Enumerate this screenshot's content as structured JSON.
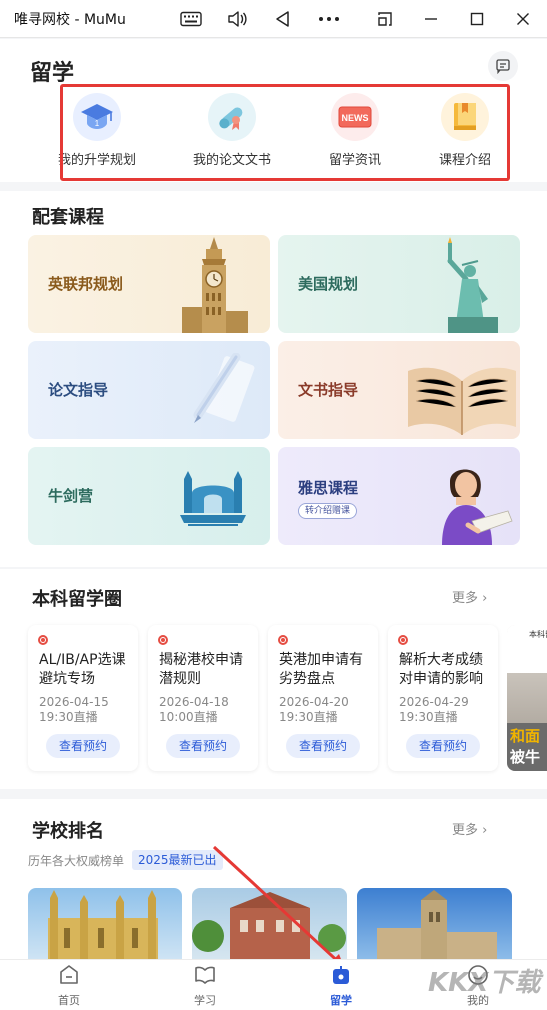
{
  "window": {
    "title": "唯寻网校 - MuMu"
  },
  "header": {
    "title": "留学"
  },
  "quick_links": [
    {
      "label": "我的升学规划",
      "icon": "graduation-cap-icon"
    },
    {
      "label": "我的论文文书",
      "icon": "diploma-scroll-icon"
    },
    {
      "label": "留学资讯",
      "icon": "news-icon"
    },
    {
      "label": "课程介绍",
      "icon": "book-icon"
    }
  ],
  "courses": {
    "title": "配套课程",
    "items": [
      {
        "label": "英联邦规划",
        "color": "#8a5a1c"
      },
      {
        "label": "美国规划",
        "color": "#2d6b5e"
      },
      {
        "label": "论文指导",
        "color": "#2c4d80"
      },
      {
        "label": "文书指导",
        "color": "#8a3b2a"
      },
      {
        "label": "牛剑营",
        "color": "#2d6b5e"
      },
      {
        "label": "雅思课程",
        "color": "#2c3f80",
        "badge": "转介绍赠课"
      }
    ]
  },
  "circle": {
    "title": "本科留学圈",
    "more": "更多",
    "events": [
      {
        "title": "AL/IB/AP选课避坑专场",
        "date": "2026-04-15",
        "time": "19:30直播",
        "button": "查看预约"
      },
      {
        "title": "揭秘港校申请潜规则",
        "date": "2026-04-18",
        "time": "10:00直播",
        "button": "查看预约"
      },
      {
        "title": "英港加申请有劣势盘点",
        "date": "2026-04-20",
        "time": "19:30直播",
        "button": "查看预约"
      },
      {
        "title": "解析大考成绩对申请的影响",
        "date": "2026-04-29",
        "time": "19:30直播",
        "button": "查看预约"
      }
    ],
    "partial_card": {
      "top": "本科留",
      "line1": "和面",
      "line2": "被牛"
    }
  },
  "ranking": {
    "title": "学校排名",
    "more": "更多",
    "subtitle": "历年各大权威榜单",
    "badge": "2025最新已出"
  },
  "nav": [
    {
      "label": "首页",
      "icon": "home-icon",
      "active": false
    },
    {
      "label": "学习",
      "icon": "book-open-icon",
      "active": false
    },
    {
      "label": "留学",
      "icon": "study-abroad-icon",
      "active": true
    },
    {
      "label": "我的",
      "icon": "profile-icon",
      "active": false
    }
  ],
  "watermark": "KKX下载",
  "colors": {
    "accent": "#2b5bd7",
    "highlight_box": "#e53935",
    "arrow": "#e53935"
  }
}
